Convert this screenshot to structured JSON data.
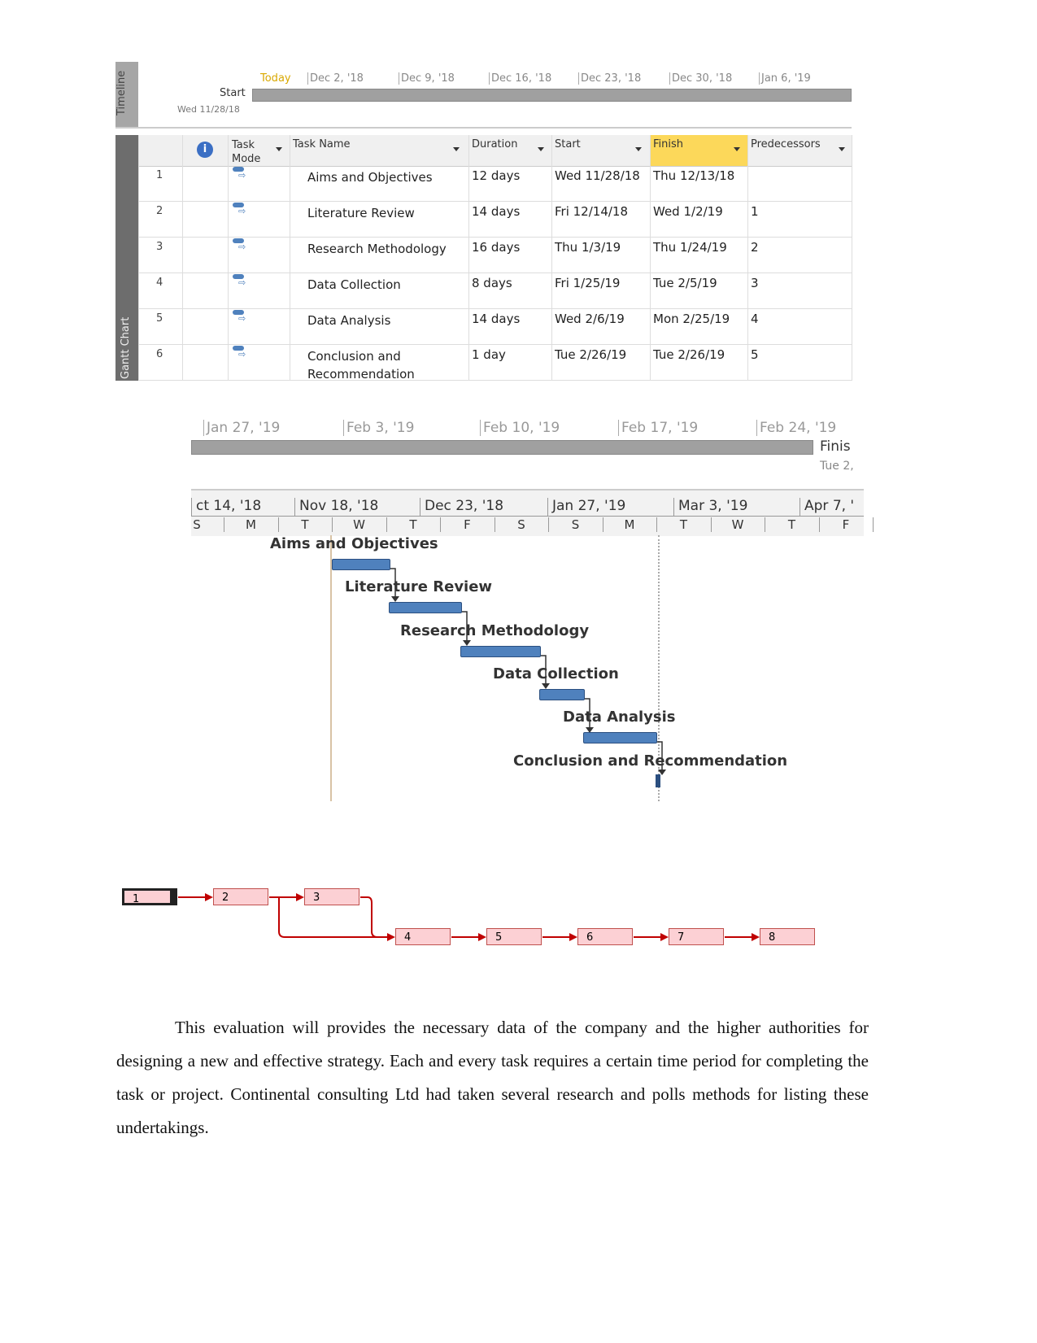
{
  "timeline": {
    "side_label": "Timeline",
    "today": "Today",
    "dates": [
      "Dec 2, '18",
      "Dec 9, '18",
      "Dec 16, '18",
      "Dec 23, '18",
      "Dec 30, '18",
      "Jan 6, '19"
    ],
    "start_label": "Start",
    "start_date": "Wed 11/28/18"
  },
  "table": {
    "side_label": "Gantt Chart",
    "headers": {
      "task_mode": "Task Mode",
      "task_name": "Task Name",
      "duration": "Duration",
      "start": "Start",
      "finish": "Finish",
      "predecessors": "Predecessors"
    },
    "rows": [
      {
        "id": "1",
        "name": "Aims and Objectives",
        "duration": "12 days",
        "start": "Wed 11/28/18",
        "finish": "Thu 12/13/18",
        "pred": ""
      },
      {
        "id": "2",
        "name": "Literature Review",
        "duration": "14 days",
        "start": "Fri 12/14/18",
        "finish": "Wed 1/2/19",
        "pred": "1"
      },
      {
        "id": "3",
        "name": "Research Methodology",
        "duration": "16 days",
        "start": "Thu 1/3/19",
        "finish": "Thu 1/24/19",
        "pred": "2"
      },
      {
        "id": "4",
        "name": "Data Collection",
        "duration": "8 days",
        "start": "Fri 1/25/19",
        "finish": "Tue 2/5/19",
        "pred": "3"
      },
      {
        "id": "5",
        "name": "Data Analysis",
        "duration": "14 days",
        "start": "Wed 2/6/19",
        "finish": "Mon 2/25/19",
        "pred": "4"
      },
      {
        "id": "6",
        "name": "Conclusion and Recommendation",
        "duration": "1 day",
        "start": "Tue 2/26/19",
        "finish": "Tue 2/26/19",
        "pred": "5"
      }
    ]
  },
  "timeline2": {
    "dates": [
      "Jan 27, '19",
      "Feb 3, '19",
      "Feb 10, '19",
      "Feb 17, '19",
      "Feb 24, '19"
    ],
    "finish_label": "Finis",
    "finish_date": "Tue 2,"
  },
  "gantt": {
    "top_scale": [
      "ct 14, '18",
      "Nov 18, '18",
      "Dec 23, '18",
      "Jan 27, '19",
      "Mar 3, '19",
      "Apr 7, '"
    ],
    "bottom_scale": [
      "S",
      "M",
      "T",
      "W",
      "T",
      "F",
      "S",
      "S",
      "M",
      "T",
      "W",
      "T",
      "F"
    ],
    "tasks": [
      "Aims and Objectives",
      "Literature Review",
      "Research Methodology",
      "Data Collection",
      "Data Analysis",
      "Conclusion and Recommendation"
    ],
    "bar_color": "#4f81bd"
  },
  "network": {
    "nodes": [
      "1",
      "2",
      "3",
      "4",
      "5",
      "6",
      "7",
      "8"
    ],
    "box_color": "#fcd0d4",
    "line_color": "#c00000"
  },
  "paragraph": [
    "This evaluation will provides the necessary data of the company and the higher authorities for designing a new and effective strategy. Each and every task requires a certain time period for completing the task or project. Continental consulting Ltd  had taken several research and polls methods for listing these undertakings."
  ]
}
